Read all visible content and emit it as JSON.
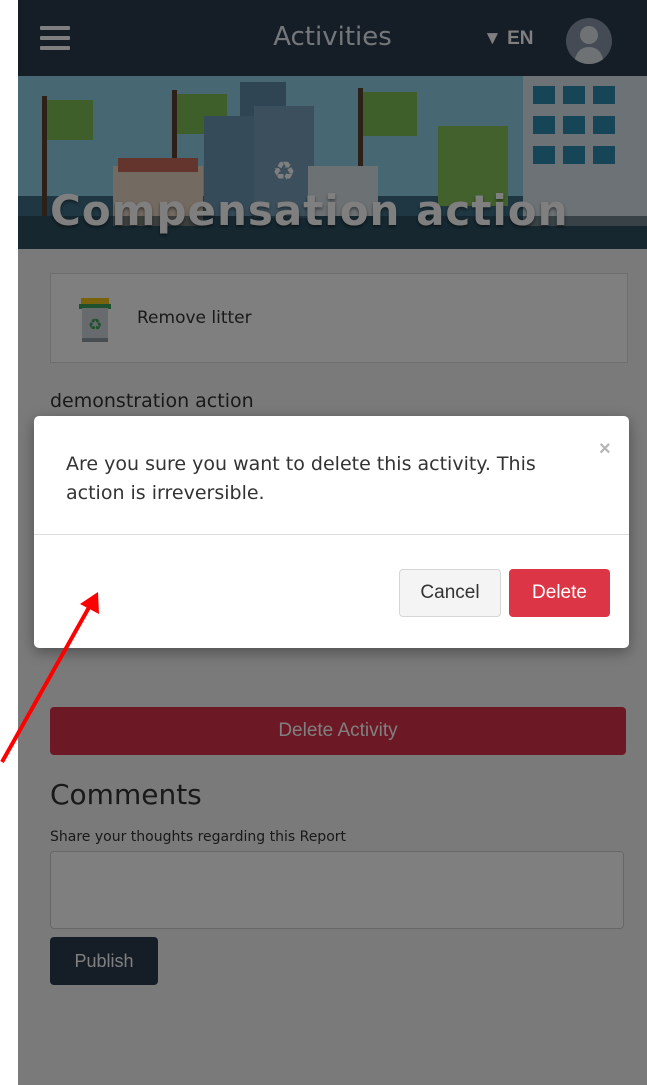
{
  "nav": {
    "title": "Activities",
    "language": "▼ EN"
  },
  "hero": {
    "title": "Compensation action"
  },
  "activity": {
    "type_label": "Remove litter",
    "description": "demonstration action",
    "delete_label": "Delete Activity"
  },
  "comments": {
    "heading": "Comments",
    "hint": "Share your thoughts regarding this Report",
    "input_value": "",
    "publish_label": "Publish"
  },
  "modal": {
    "message": "Are you sure you want to delete this activity. This action is irreversible.",
    "close_glyph": "×",
    "cancel_label": "Cancel",
    "delete_label": "Delete"
  },
  "colors": {
    "topbar": "#2b3a4c",
    "danger": "#dc3545",
    "annotation_arrow": "#ff0000"
  },
  "icons": [
    "menu-icon",
    "user-avatar-icon",
    "recycle-bin-icon",
    "close-icon"
  ]
}
